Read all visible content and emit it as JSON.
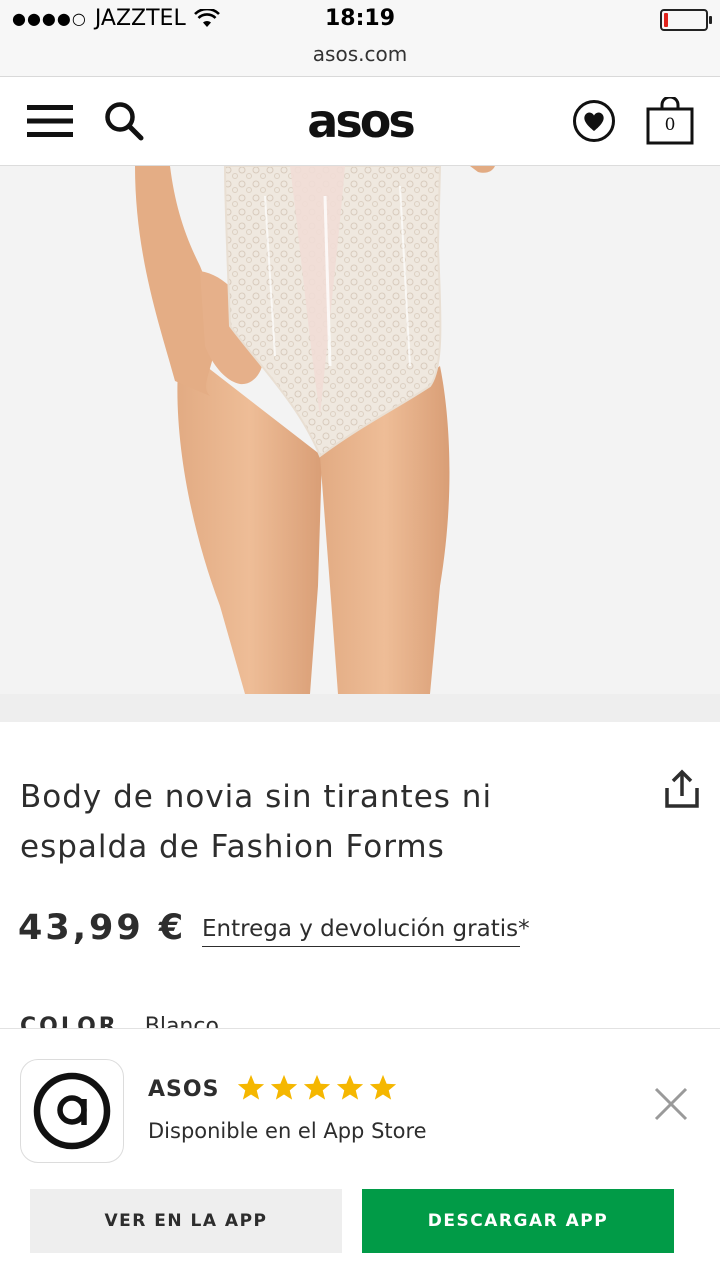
{
  "status_bar": {
    "carrier": "JAZZTEL",
    "signal_dots": "●●●●○",
    "time": "18:19",
    "url": "asos.com",
    "battery_color": "#e0231c"
  },
  "header": {
    "logo": "asos",
    "bag_count": "0",
    "icons": [
      "menu-icon",
      "search-icon",
      "heart-icon",
      "bag-icon"
    ]
  },
  "gallery": {
    "slides": 4,
    "active_index": 3
  },
  "product": {
    "title_line1": "Body de novia sin tirantes ni",
    "title_line2": "espalda de Fashion Forms",
    "price": "43,99 €",
    "delivery": "Entrega y devolución gratis*",
    "color_label": "COLOR",
    "color_value": "Blanco"
  },
  "app_banner": {
    "name": "ASOS",
    "rating_stars": 5,
    "subtitle": "Disponible en el App Store",
    "open_button": "VER EN LA APP",
    "download_button": "DESCARGAR APP",
    "colors": {
      "star": "#f5b700",
      "download": "#019b47"
    }
  }
}
